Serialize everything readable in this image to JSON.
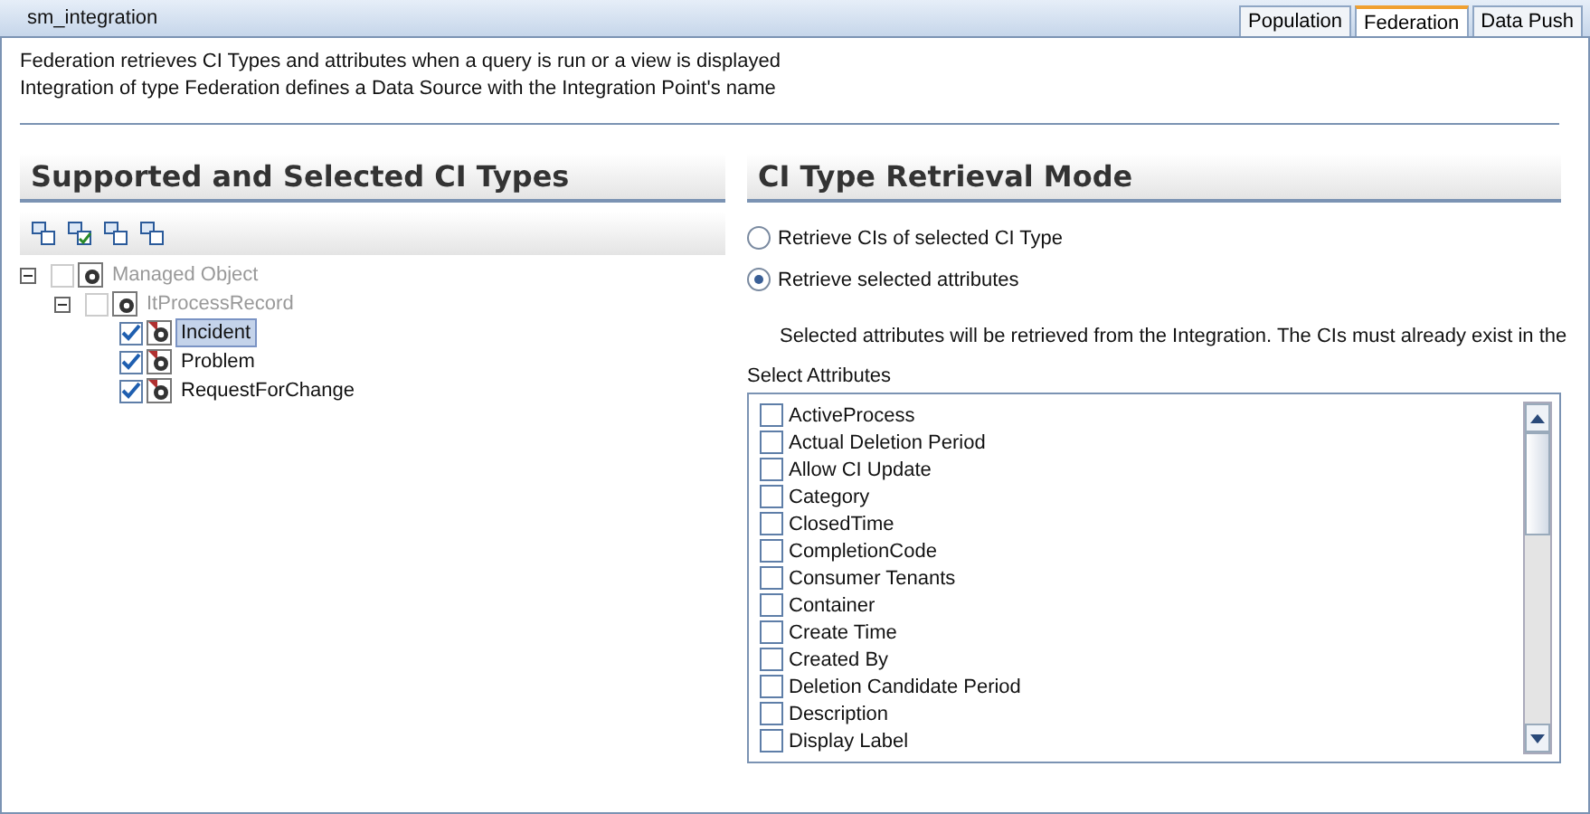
{
  "window": {
    "title": "sm_integration"
  },
  "tabs": [
    {
      "label": "Population",
      "selected": false
    },
    {
      "label": "Federation",
      "selected": true
    },
    {
      "label": "Data Push",
      "selected": false
    }
  ],
  "description": [
    "Federation retrieves CI Types and attributes when a query is run or a view is displayed",
    "Integration of type Federation defines a Data Source with the Integration Point's name"
  ],
  "left_panel": {
    "heading": "Supported and Selected CI Types",
    "tree": [
      {
        "label": "Managed Object",
        "checked": false,
        "disabled": true,
        "selected": false,
        "expanded": true,
        "children": [
          {
            "label": "ItProcessRecord",
            "checked": false,
            "disabled": true,
            "selected": false,
            "expanded": true,
            "children": [
              {
                "label": "Incident",
                "checked": true,
                "disabled": false,
                "selected": true
              },
              {
                "label": "Problem",
                "checked": true,
                "disabled": false,
                "selected": false
              },
              {
                "label": "RequestForChange",
                "checked": true,
                "disabled": false,
                "selected": false
              }
            ]
          }
        ]
      }
    ]
  },
  "right_panel": {
    "heading": "CI Type Retrieval Mode",
    "modes": [
      {
        "label": "Retrieve CIs of selected CI Type",
        "selected": false
      },
      {
        "label": "Retrieve selected attributes",
        "selected": true
      }
    ],
    "note": "Selected attributes will be retrieved from the Integration. The CIs must already exist in the",
    "attributes_label": "Select Attributes",
    "attributes": [
      {
        "label": "ActiveProcess",
        "checked": false
      },
      {
        "label": "Actual Deletion Period",
        "checked": false
      },
      {
        "label": "Allow CI Update",
        "checked": false
      },
      {
        "label": "Category",
        "checked": false
      },
      {
        "label": "ClosedTime",
        "checked": false
      },
      {
        "label": "CompletionCode",
        "checked": false
      },
      {
        "label": "Consumer Tenants",
        "checked": false
      },
      {
        "label": "Container",
        "checked": false
      },
      {
        "label": "Create Time",
        "checked": false
      },
      {
        "label": "Created By",
        "checked": false
      },
      {
        "label": "Deletion Candidate Period",
        "checked": false
      },
      {
        "label": "Description",
        "checked": false
      },
      {
        "label": "Display Label",
        "checked": false
      }
    ]
  }
}
